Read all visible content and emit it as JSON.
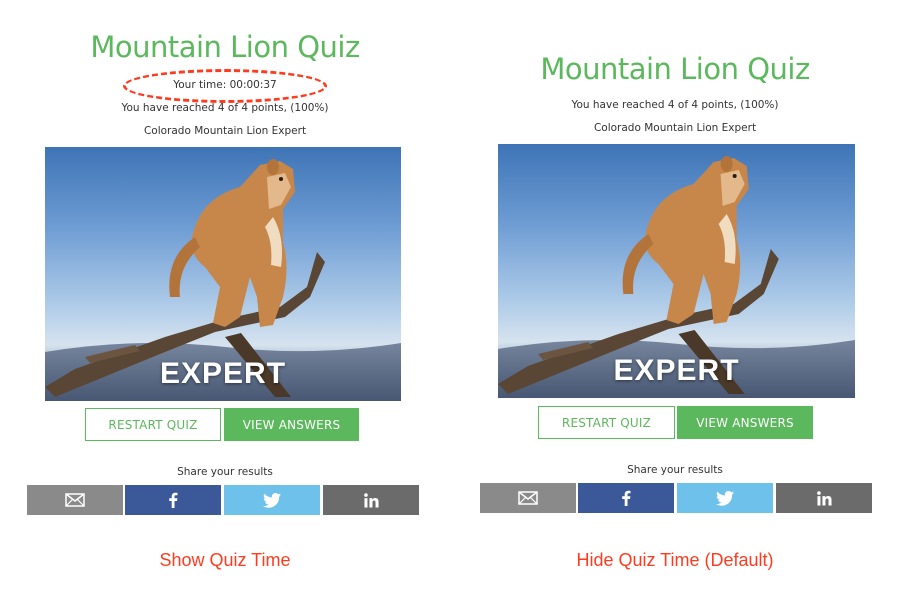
{
  "colors": {
    "accent_green": "#5cb85c",
    "annotation_red": "#ff3b1f",
    "email_gray": "#8a8a8a",
    "facebook_blue": "#3b5998",
    "twitter_blue": "#6ec1ea",
    "linkedin_gray": "#6b6b6b"
  },
  "left": {
    "title": "Mountain Lion Quiz",
    "time_text": "Your time: 00:00:37",
    "points_text": "You have reached 4 of 4 points, (100%)",
    "rank_text": "Colorado Mountain Lion Expert",
    "image_badge": "EXPERT",
    "restart_label": "RESTART QUIZ",
    "view_answers_label": "VIEW ANSWERS",
    "share_label": "Share your results",
    "share_icons": [
      "envelope-icon",
      "facebook-icon",
      "twitter-icon",
      "linkedin-icon"
    ],
    "caption": "Show Quiz Time"
  },
  "right": {
    "title": "Mountain Lion Quiz",
    "points_text": "You have reached 4 of 4 points, (100%)",
    "rank_text": "Colorado Mountain Lion Expert",
    "image_badge": "EXPERT",
    "restart_label": "RESTART QUIZ",
    "view_answers_label": "VIEW ANSWERS",
    "share_label": "Share your results",
    "share_icons": [
      "envelope-icon",
      "facebook-icon",
      "twitter-icon",
      "linkedin-icon"
    ],
    "caption": "Hide Quiz Time (Default)"
  }
}
